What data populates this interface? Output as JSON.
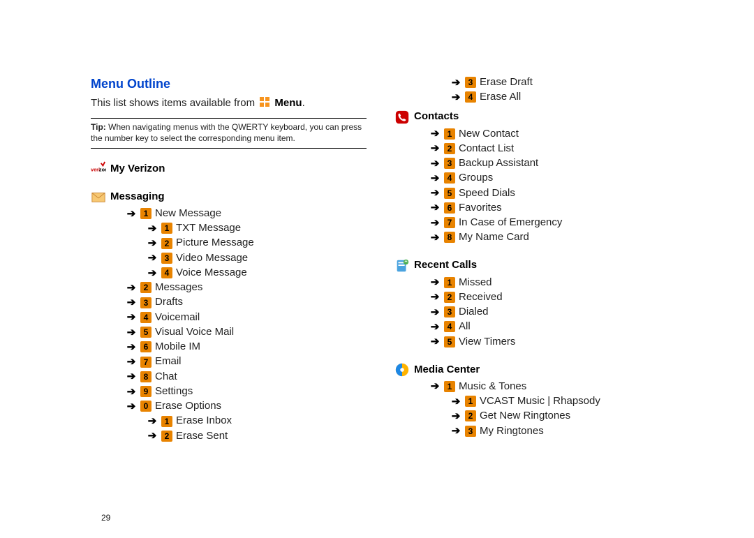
{
  "header": {
    "title": "Menu Outline",
    "intro_prefix": "This list shows items available from ",
    "menu_word": "Menu"
  },
  "tip": {
    "label": "Tip:",
    "text": " When navigating menus with the QWERTY keyboard, you can press the number key to select the corresponding menu item."
  },
  "left": {
    "my_verizon": "My Verizon",
    "messaging": "Messaging",
    "messaging_items": [
      {
        "n": "1",
        "label": "New Message",
        "indent": 1
      },
      {
        "n": "1",
        "label": "TXT Message",
        "indent": 2
      },
      {
        "n": "2",
        "label": "Picture Message",
        "indent": 2
      },
      {
        "n": "3",
        "label": "Video Message",
        "indent": 2
      },
      {
        "n": "4",
        "label": "Voice Message",
        "indent": 2
      },
      {
        "n": "2",
        "label": "Messages",
        "indent": 1
      },
      {
        "n": "3",
        "label": "Drafts",
        "indent": 1
      },
      {
        "n": "4",
        "label": "Voicemail",
        "indent": 1
      },
      {
        "n": "5",
        "label": "Visual Voice Mail",
        "indent": 1
      },
      {
        "n": "6",
        "label": "Mobile IM",
        "indent": 1
      },
      {
        "n": "7",
        "label": "Email",
        "indent": 1
      },
      {
        "n": "8",
        "label": "Chat",
        "indent": 1
      },
      {
        "n": "9",
        "label": "Settings",
        "indent": 1
      },
      {
        "n": "0",
        "label": "Erase Options",
        "indent": 1
      },
      {
        "n": "1",
        "label": "Erase Inbox",
        "indent": 2
      },
      {
        "n": "2",
        "label": "Erase Sent",
        "indent": 2
      }
    ]
  },
  "right": {
    "leading_items": [
      {
        "n": "3",
        "label": "Erase Draft",
        "indent": 2
      },
      {
        "n": "4",
        "label": "Erase All",
        "indent": 2
      }
    ],
    "contacts": "Contacts",
    "contacts_items": [
      {
        "n": "1",
        "label": "New Contact",
        "indent": 1
      },
      {
        "n": "2",
        "label": "Contact List",
        "indent": 1
      },
      {
        "n": "3",
        "label": "Backup Assistant",
        "indent": 1
      },
      {
        "n": "4",
        "label": "Groups",
        "indent": 1
      },
      {
        "n": "5",
        "label": "Speed Dials",
        "indent": 1
      },
      {
        "n": "6",
        "label": "Favorites",
        "indent": 1
      },
      {
        "n": "7",
        "label": "In Case of Emergency",
        "indent": 1
      },
      {
        "n": "8",
        "label": "My Name Card",
        "indent": 1
      }
    ],
    "recent_calls": "Recent Calls",
    "recent_items": [
      {
        "n": "1",
        "label": "Missed",
        "indent": 1
      },
      {
        "n": "2",
        "label": "Received",
        "indent": 1
      },
      {
        "n": "3",
        "label": "Dialed",
        "indent": 1
      },
      {
        "n": "4",
        "label": "All",
        "indent": 1
      },
      {
        "n": "5",
        "label": "View Timers",
        "indent": 1
      }
    ],
    "media_center": "Media Center",
    "media_items": [
      {
        "n": "1",
        "label": "Music & Tones",
        "indent": 1
      },
      {
        "n": "1",
        "label": "VCAST Music | Rhapsody",
        "indent": 2
      },
      {
        "n": "2",
        "label": "Get New Ringtones",
        "indent": 2
      },
      {
        "n": "3",
        "label": "My Ringtones",
        "indent": 2
      }
    ]
  },
  "page_number": "29"
}
